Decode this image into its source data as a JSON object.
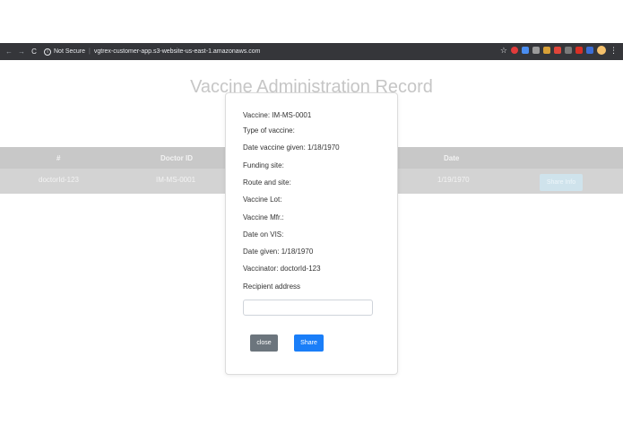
{
  "browser": {
    "back": "←",
    "forward": "→",
    "reload": "C",
    "security_label": "Not Secure",
    "url": "vgtrex-customer-app.s3-website-us-east-1.amazonaws.com",
    "star": "☆",
    "menu": "⋮"
  },
  "page": {
    "title": "Vaccine Administration Record",
    "table": {
      "headers": [
        "#",
        "Doctor ID",
        "Date"
      ],
      "row": [
        "doctorId-123",
        "IM-MS-0001",
        "1/19/1970"
      ],
      "share_button": "Share Info"
    }
  },
  "modal": {
    "fields": [
      "Vaccine: IM-MS-0001",
      "Type of vaccine:",
      "Date vaccine given: 1/18/1970",
      "Funding site:",
      "Route and site:",
      "Vaccine Lot:",
      "Vaccine Mfr.:",
      "Date on VIS:",
      "Date given: 1/18/1970",
      "Vaccinator: doctorId-123",
      "Recipient address"
    ],
    "recipient_value": "",
    "close_label": "close",
    "share_label": "Share"
  },
  "colors": {
    "browser_bar": "#35363a",
    "table_header": "#c8c8c8",
    "close_button": "#6c757d",
    "share_button": "#1a7ef8"
  },
  "icons": [
    "back-arrow-icon",
    "forward-arrow-icon",
    "reload-icon",
    "info-icon",
    "star-icon",
    "menu-dots-icon"
  ]
}
